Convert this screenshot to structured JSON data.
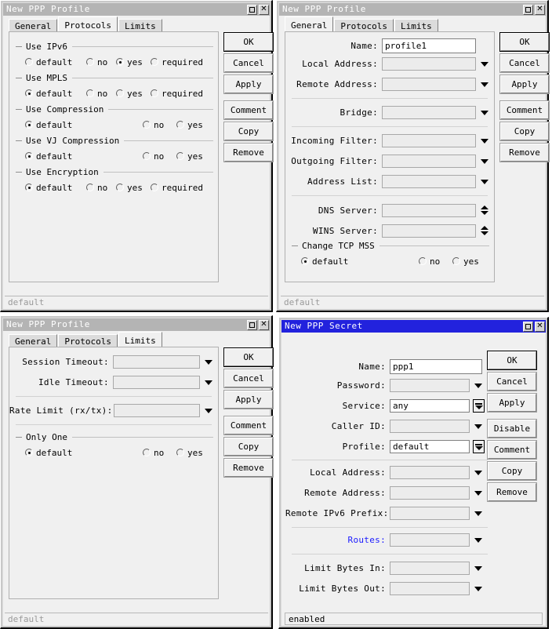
{
  "windows": {
    "protocols": {
      "title": "New PPP Profile",
      "titlebar_state": "inactive",
      "tabs": [
        {
          "label": "General",
          "selected": false
        },
        {
          "label": "Protocols",
          "selected": true
        },
        {
          "label": "Limits",
          "selected": false
        }
      ],
      "groups": [
        {
          "label": "Use IPv6",
          "options": [
            {
              "label": "default",
              "selected": false
            },
            {
              "label": "no",
              "selected": false
            },
            {
              "label": "yes",
              "selected": true
            },
            {
              "label": "required",
              "selected": false
            }
          ]
        },
        {
          "label": "Use MPLS",
          "options": [
            {
              "label": "default",
              "selected": true
            },
            {
              "label": "no",
              "selected": false
            },
            {
              "label": "yes",
              "selected": false
            },
            {
              "label": "required",
              "selected": false
            }
          ]
        },
        {
          "label": "Use Compression",
          "options": [
            {
              "label": "default",
              "selected": true
            },
            {
              "label": "no",
              "selected": false
            },
            {
              "label": "yes",
              "selected": false
            }
          ]
        },
        {
          "label": "Use VJ Compression",
          "options": [
            {
              "label": "default",
              "selected": true
            },
            {
              "label": "no",
              "selected": false
            },
            {
              "label": "yes",
              "selected": false
            }
          ]
        },
        {
          "label": "Use Encryption",
          "options": [
            {
              "label": "default",
              "selected": true
            },
            {
              "label": "no",
              "selected": false
            },
            {
              "label": "yes",
              "selected": false
            },
            {
              "label": "required",
              "selected": false
            }
          ]
        }
      ],
      "buttons": [
        "OK",
        "Cancel",
        "Apply",
        "Comment",
        "Copy",
        "Remove"
      ],
      "status": "default"
    },
    "general": {
      "title": "New PPP Profile",
      "titlebar_state": "inactive",
      "tabs": [
        {
          "label": "General",
          "selected": true
        },
        {
          "label": "Protocols",
          "selected": false
        },
        {
          "label": "Limits",
          "selected": false
        }
      ],
      "fields": [
        {
          "label": "Name:",
          "value": "profile1",
          "control": "text",
          "filled": true
        },
        {
          "label": "Local Address:",
          "value": "",
          "control": "dropdown",
          "filled": false
        },
        {
          "label": "Remote Address:",
          "value": "",
          "control": "dropdown",
          "filled": false
        },
        {
          "label": "Bridge:",
          "value": "",
          "control": "dropdown",
          "filled": false
        },
        {
          "label": "Incoming Filter:",
          "value": "",
          "control": "dropdown",
          "filled": false
        },
        {
          "label": "Outgoing Filter:",
          "value": "",
          "control": "dropdown",
          "filled": false
        },
        {
          "label": "Address List:",
          "value": "",
          "control": "dropdown",
          "filled": false
        },
        {
          "label": "DNS Server:",
          "value": "",
          "control": "spinner",
          "filled": false
        },
        {
          "label": "WINS Server:",
          "value": "",
          "control": "spinner",
          "filled": false
        }
      ],
      "group": {
        "label": "Change TCP MSS",
        "options": [
          {
            "label": "default",
            "selected": true
          },
          {
            "label": "no",
            "selected": false
          },
          {
            "label": "yes",
            "selected": false
          }
        ]
      },
      "buttons": [
        "OK",
        "Cancel",
        "Apply",
        "Comment",
        "Copy",
        "Remove"
      ],
      "status": "default"
    },
    "limits": {
      "title": "New PPP Profile",
      "titlebar_state": "inactive",
      "tabs": [
        {
          "label": "General",
          "selected": false
        },
        {
          "label": "Protocols",
          "selected": false
        },
        {
          "label": "Limits",
          "selected": true
        }
      ],
      "fields": [
        {
          "label": "Session Timeout:",
          "value": "",
          "control": "dropdown"
        },
        {
          "label": "Idle Timeout:",
          "value": "",
          "control": "dropdown"
        },
        {
          "label": "Rate Limit (rx/tx):",
          "value": "",
          "control": "dropdown"
        }
      ],
      "group": {
        "label": "Only One",
        "options": [
          {
            "label": "default",
            "selected": true
          },
          {
            "label": "no",
            "selected": false
          },
          {
            "label": "yes",
            "selected": false
          }
        ]
      },
      "buttons": [
        "OK",
        "Cancel",
        "Apply",
        "Comment",
        "Copy",
        "Remove"
      ],
      "status": "default"
    },
    "secret": {
      "title": "New PPP Secret",
      "titlebar_state": "active",
      "fields": [
        {
          "label": "Name:",
          "value": "ppp1",
          "control": "text",
          "filled": true
        },
        {
          "label": "Password:",
          "value": "",
          "control": "dropdown",
          "filled": false
        },
        {
          "label": "Service:",
          "value": "any",
          "control": "dropdown-box",
          "filled": true
        },
        {
          "label": "Caller ID:",
          "value": "",
          "control": "dropdown",
          "filled": false
        },
        {
          "label": "Profile:",
          "value": "default",
          "control": "dropdown-box",
          "filled": true
        },
        {
          "label": "Local Address:",
          "value": "",
          "control": "dropdown",
          "filled": false
        },
        {
          "label": "Remote Address:",
          "value": "",
          "control": "dropdown",
          "filled": false
        },
        {
          "label": "Remote IPv6 Prefix:",
          "value": "",
          "control": "dropdown",
          "filled": false
        },
        {
          "label": "Routes:",
          "value": "",
          "control": "dropdown",
          "filled": false,
          "link": true
        },
        {
          "label": "Limit Bytes In:",
          "value": "",
          "control": "dropdown",
          "filled": false
        },
        {
          "label": "Limit Bytes Out:",
          "value": "",
          "control": "dropdown",
          "filled": false
        }
      ],
      "buttons": [
        "OK",
        "Cancel",
        "Apply",
        "Disable",
        "Comment",
        "Copy",
        "Remove"
      ],
      "status": "enabled"
    }
  },
  "colors": {
    "active_title": "#2222dd",
    "inactive_title": "#b4b4b4",
    "window_bg": "#f0f0f0",
    "link": "#1a1aff"
  },
  "icons": {
    "maximize": "maximize-icon",
    "close": "close-icon"
  }
}
